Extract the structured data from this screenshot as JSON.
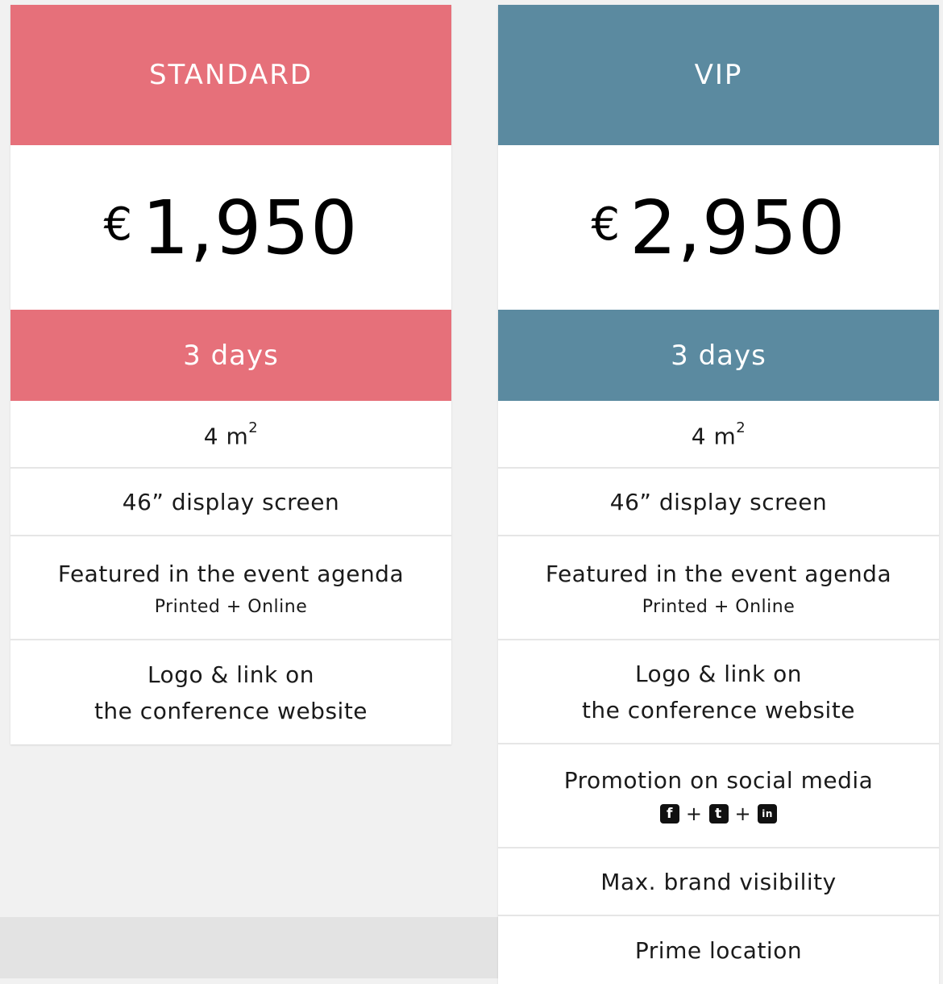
{
  "colors": {
    "standard": "#e6707a",
    "vip": "#5b8aa0"
  },
  "plans": [
    {
      "name": "STANDARD",
      "currency": "€",
      "price": "1,950",
      "duration": "3 days",
      "size_value": "4 m",
      "size_sup": "2",
      "screen": "46” display screen",
      "agenda_title": "Featured in the event agenda",
      "agenda_sub": "Printed + Online",
      "logo_line1": "Logo & link on",
      "logo_line2": "the conference website"
    },
    {
      "name": "VIP",
      "currency": "€",
      "price": "2,950",
      "duration": "3 days",
      "size_value": "4 m",
      "size_sup": "2",
      "screen": "46” display screen",
      "agenda_title": "Featured in the event agenda",
      "agenda_sub": "Printed + Online",
      "logo_line1": "Logo & link on",
      "logo_line2": "the conference website",
      "social_title": "Promotion on social media",
      "social_icons": [
        "facebook-icon",
        "tumblr-icon",
        "linkedin-icon"
      ],
      "social_glyphs": {
        "facebook": "f",
        "tumblr": "t",
        "linkedin": "in"
      },
      "social_plus": "+",
      "visibility": "Max. brand visibility",
      "location": "Prime location"
    }
  ]
}
